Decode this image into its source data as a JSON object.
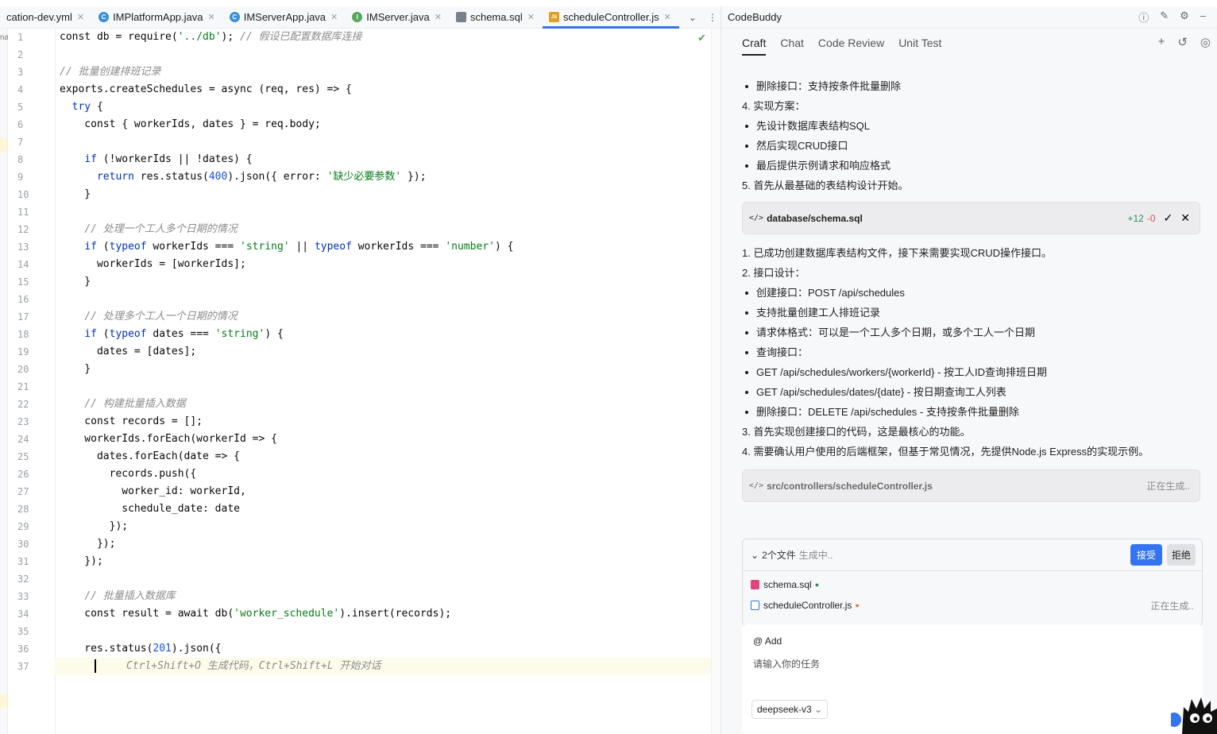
{
  "editor": {
    "tabs": [
      {
        "label": "cation-dev.yml",
        "icon": "yaml-file-icon"
      },
      {
        "label": "IMPlatformApp.java",
        "icon": "java-class-icon"
      },
      {
        "label": "IMServerApp.java",
        "icon": "java-class-icon"
      },
      {
        "label": "IMServer.java",
        "icon": "java-interface-icon"
      },
      {
        "label": "schema.sql",
        "icon": "sql-file-icon"
      },
      {
        "label": "scheduleController.js",
        "icon": "js-file-icon"
      }
    ],
    "line_numbers": [
      "1",
      "2",
      "3",
      "4",
      "5",
      "6",
      "7",
      "8",
      "9",
      "10",
      "11",
      "12",
      "13",
      "14",
      "15",
      "16",
      "17",
      "18",
      "19",
      "20",
      "21",
      "22",
      "23",
      "24",
      "25",
      "26",
      "27",
      "28",
      "29",
      "30",
      "31",
      "32",
      "33",
      "34",
      "35",
      "36",
      "37"
    ],
    "lines": [
      [
        [
          "plain",
          "const db = require("
        ],
        [
          "str",
          "'../db'"
        ],
        [
          "plain",
          "); "
        ],
        [
          "cm",
          "// 假设已配置数据库连接"
        ]
      ],
      [],
      [
        [
          "cm",
          "// 批量创建排班记录"
        ]
      ],
      [
        [
          "plain",
          "exports.createSchedules = async (req, res) => {"
        ]
      ],
      [
        [
          "plain",
          "  "
        ],
        [
          "kw",
          "try"
        ],
        [
          "plain",
          " {"
        ]
      ],
      [
        [
          "plain",
          "    const { workerIds, dates } = req.body;"
        ]
      ],
      [],
      [
        [
          "plain",
          "    "
        ],
        [
          "kw",
          "if"
        ],
        [
          "plain",
          " (!workerIds || !dates) {"
        ]
      ],
      [
        [
          "plain",
          "      "
        ],
        [
          "kw",
          "return"
        ],
        [
          "plain",
          " res.status("
        ],
        [
          "num",
          "400"
        ],
        [
          "plain",
          ").json({ error: "
        ],
        [
          "str",
          "'缺少必要参数'"
        ],
        [
          "plain",
          " });"
        ]
      ],
      [
        [
          "plain",
          "    }"
        ]
      ],
      [],
      [
        [
          "plain",
          "    "
        ],
        [
          "cm",
          "// 处理一个工人多个日期的情况"
        ]
      ],
      [
        [
          "plain",
          "    "
        ],
        [
          "kw",
          "if"
        ],
        [
          "plain",
          " ("
        ],
        [
          "kw",
          "typeof"
        ],
        [
          "plain",
          " workerIds === "
        ],
        [
          "str",
          "'string'"
        ],
        [
          "plain",
          " || "
        ],
        [
          "kw",
          "typeof"
        ],
        [
          "plain",
          " workerIds === "
        ],
        [
          "str",
          "'number'"
        ],
        [
          "plain",
          ") {"
        ]
      ],
      [
        [
          "plain",
          "      workerIds = [workerIds];"
        ]
      ],
      [
        [
          "plain",
          "    }"
        ]
      ],
      [],
      [
        [
          "plain",
          "    "
        ],
        [
          "cm",
          "// 处理多个工人一个日期的情况"
        ]
      ],
      [
        [
          "plain",
          "    "
        ],
        [
          "kw",
          "if"
        ],
        [
          "plain",
          " ("
        ],
        [
          "kw",
          "typeof"
        ],
        [
          "plain",
          " dates === "
        ],
        [
          "str",
          "'string'"
        ],
        [
          "plain",
          ") {"
        ]
      ],
      [
        [
          "plain",
          "      dates = [dates];"
        ]
      ],
      [
        [
          "plain",
          "    }"
        ]
      ],
      [],
      [
        [
          "plain",
          "    "
        ],
        [
          "cm",
          "// 构建批量插入数据"
        ]
      ],
      [
        [
          "plain",
          "    const records = [];"
        ]
      ],
      [
        [
          "plain",
          "    workerIds.forEach(workerId => {"
        ]
      ],
      [
        [
          "plain",
          "      dates.forEach(date => {"
        ]
      ],
      [
        [
          "plain",
          "        records.push({"
        ]
      ],
      [
        [
          "plain",
          "          worker_id: workerId,"
        ]
      ],
      [
        [
          "plain",
          "          schedule_date: date"
        ]
      ],
      [
        [
          "plain",
          "        });"
        ]
      ],
      [
        [
          "plain",
          "      });"
        ]
      ],
      [
        [
          "plain",
          "    });"
        ]
      ],
      [],
      [
        [
          "plain",
          "    "
        ],
        [
          "cm",
          "// 批量插入数据库"
        ]
      ],
      [
        [
          "plain",
          "    const result = await db("
        ],
        [
          "str",
          "'worker_schedule'"
        ],
        [
          "plain",
          ").insert(records);"
        ]
      ],
      [],
      [
        [
          "plain",
          "    res.status("
        ],
        [
          "num",
          "201"
        ],
        [
          "plain",
          ").json({"
        ]
      ]
    ],
    "hint_line": "Ctrl+Shift+O 生成代码，Ctrl+Shift+L 开始对话",
    "strip_label": "na"
  },
  "panel": {
    "title": "CodeBuddy",
    "tabs": [
      "Craft",
      "Chat",
      "Code Review",
      "Unit Test"
    ],
    "message1": [
      {
        "t": "删除接口：支持按条件批量删除",
        "bul": true
      },
      {
        "t": "4. 实现方案：",
        "bul": false
      },
      {
        "t": "先设计数据库表结构SQL",
        "bul": true
      },
      {
        "t": "然后实现CRUD接口",
        "bul": true
      },
      {
        "t": "最后提供示例请求和响应格式",
        "bul": true
      },
      {
        "t": "5. 首先从最基础的表结构设计开始。",
        "bul": false
      }
    ],
    "file_card1": {
      "icon": "</>",
      "name": "database/schema.sql",
      "added": "+12",
      "removed": "-0"
    },
    "message2": [
      {
        "t": "1. 已成功创建数据库表结构文件，接下来需要实现CRUD操作接口。",
        "bul": false
      },
      {
        "t": "2. 接口设计：",
        "bul": false
      },
      {
        "t": "创建接口：POST /api/schedules",
        "bul": true
      },
      {
        "t": "支持批量创建工人排班记录",
        "bul": true
      },
      {
        "t": "请求体格式：可以是一个工人多个日期，或多个工人一个日期",
        "bul": true
      },
      {
        "t": "查询接口：",
        "bul": true
      },
      {
        "t": "GET /api/schedules/workers/{workerId} - 按工人ID查询排班日期",
        "bul": true
      },
      {
        "t": "GET /api/schedules/dates/{date} - 按日期查询工人列表",
        "bul": true
      },
      {
        "t": "删除接口：DELETE /api/schedules - 支持按条件批量删除",
        "bul": true
      },
      {
        "t": "3. 首先实现创建接口的代码，这是最核心的功能。",
        "bul": false
      },
      {
        "t": "4. 需要确认用户使用的后端框架，但基于常见情况，先提供Node.js Express的实现示例。",
        "bul": false
      }
    ],
    "file_card2": {
      "icon": "</>",
      "name": "src/controllers/scheduleController.js",
      "status": "正在生成.."
    },
    "generating_box": {
      "count_label": "2个文件",
      "status": "生成中..",
      "accept": "接受",
      "reject": "拒绝",
      "files": [
        {
          "name": "schema.sql",
          "dot_color": "#2e8b57",
          "status": ""
        },
        {
          "name": "scheduleController.js",
          "dot_color": "#e8734a",
          "status": "正在生成.."
        }
      ]
    },
    "input": {
      "mention": "@ Add",
      "placeholder": "请输入你的任务",
      "model": "deepseek-v3"
    }
  }
}
